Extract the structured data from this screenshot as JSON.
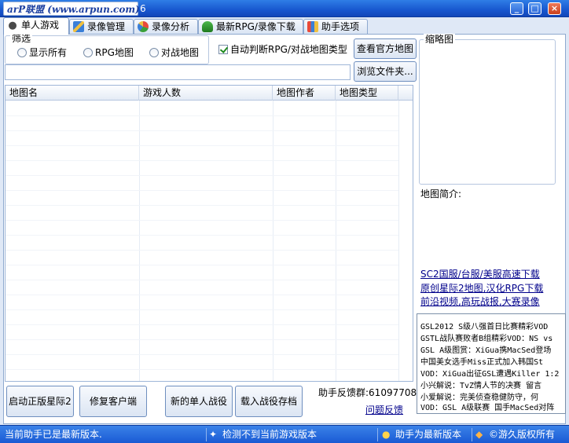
{
  "window": {
    "title": "arP联盟 (www.arpun.com)",
    "title_suffix": "6",
    "controls": [
      "_",
      "□",
      "×"
    ]
  },
  "tabs": [
    {
      "label": "单人游戏",
      "icon": "gamepad-icon",
      "active": true
    },
    {
      "label": "录像管理",
      "icon": "edit-icon",
      "active": false
    },
    {
      "label": "录像分析",
      "icon": "pie-chart-icon",
      "active": false
    },
    {
      "label": "最新RPG/录像下载",
      "icon": "download-icon",
      "active": false
    },
    {
      "label": "助手选项",
      "icon": "options-icon",
      "active": false
    }
  ],
  "filter": {
    "legend": "筛选",
    "options": [
      {
        "label": "显示所有",
        "selected": false
      },
      {
        "label": "RPG地图",
        "selected": false
      },
      {
        "label": "对战地图",
        "selected": false
      }
    ]
  },
  "auto_detect": {
    "label": "自动判断RPG/对战地图类型",
    "checked": true
  },
  "buttons": {
    "official_maps": "查看官方地图",
    "browse": "浏览文件夹...",
    "launch": "启动正版星际2",
    "repair": "修复客户端",
    "new_campaign": "新的单人战役",
    "load_save": "载入战役存档"
  },
  "path_input": {
    "value": "",
    "placeholder": ""
  },
  "table": {
    "columns": [
      "地图名",
      "游戏人数",
      "地图作者",
      "地图类型"
    ],
    "rows": []
  },
  "thumbnail": {
    "legend": "缩略图"
  },
  "map_intro": "地图简介:",
  "links": [
    "SC2国服/台服/美服高速下载",
    "原创星际2地图,汉化RPG下载",
    "前沿视频,高玩战报,大赛录像"
  ],
  "news": [
    "GSL2012 S级八强首日比赛精彩VOD",
    "GSTL战队赛败者B组精彩VOD：NS vs",
    "GSL A级图赏：XiGua携MacSed登场",
    "中国美女选手Miss正式加入韩国St",
    "VOD：XiGua出征GSL遭遇Killer 1:2",
    "小兴解说：TvZ情人节的决赛 留言",
    "小爱解说：完美侦查稳健防守，何",
    "VOD：GSL A级联赛 国手MacSed对阵"
  ],
  "feedback": {
    "group": "助手反馈群:61097708",
    "link": "问题反馈"
  },
  "status": {
    "msg1": "当前助手已是最新版本.",
    "msg2": "检测不到当前游戏版本",
    "msg3": "助手为最新版本",
    "msg4": "©游久版权所有"
  },
  "colors": {
    "titlebar": "#1857cf",
    "background": "#dfe8f6",
    "link": "#00008b"
  }
}
